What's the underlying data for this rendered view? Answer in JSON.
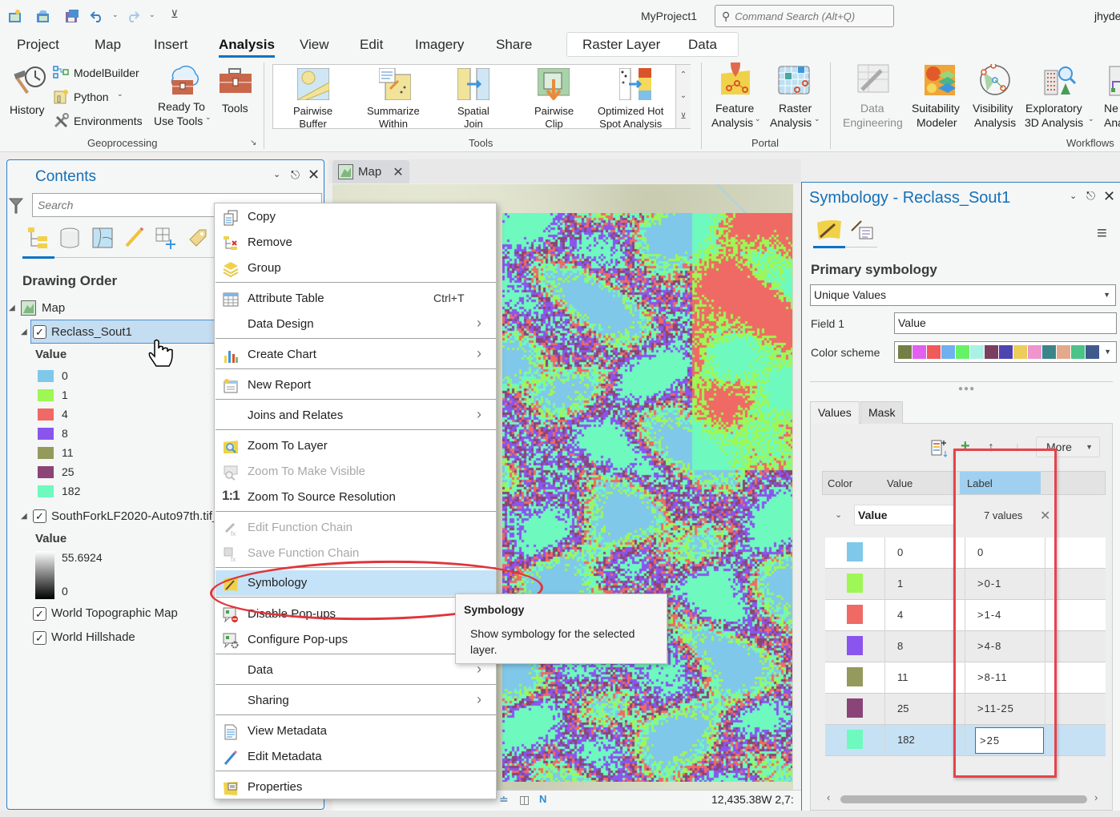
{
  "app": {
    "project_name": "MyProject1",
    "command_search_placeholder": "Command Search (Alt+Q)",
    "user": "jhyde"
  },
  "quick_access": {
    "icons": [
      "new-project-icon",
      "open-project-icon",
      "save-project-icon",
      "undo-icon",
      "redo-icon",
      "customize-toolbar-icon"
    ]
  },
  "ribbon_tabs": [
    {
      "label": "Project",
      "active": false
    },
    {
      "label": "Map",
      "active": false
    },
    {
      "label": "Insert",
      "active": false
    },
    {
      "label": "Analysis",
      "active": true
    },
    {
      "label": "View",
      "active": false
    },
    {
      "label": "Edit",
      "active": false
    },
    {
      "label": "Imagery",
      "active": false
    },
    {
      "label": "Share",
      "active": false
    }
  ],
  "contextual_tabs": [
    {
      "label": "Raster Layer"
    },
    {
      "label": "Data"
    }
  ],
  "ribbon": {
    "geoprocessing": {
      "group_label": "Geoprocessing",
      "history": "History",
      "modelbuilder": "ModelBuilder",
      "python": "Python",
      "environments": "Environments",
      "ready_to_use_1": "Ready To",
      "ready_to_use_2": "Use Tools",
      "tools": "Tools"
    },
    "tools": {
      "group_label": "Tools",
      "items": [
        {
          "line1": "Pairwise",
          "line2": "Buffer"
        },
        {
          "line1": "Summarize",
          "line2": "Within"
        },
        {
          "line1": "Spatial",
          "line2": "Join"
        },
        {
          "line1": "Pairwise",
          "line2": "Clip"
        },
        {
          "line1": "Optimized Hot",
          "line2": "Spot Analysis"
        }
      ]
    },
    "portal": {
      "group_label": "Portal",
      "feature_1": "Feature",
      "feature_2": "Analysis",
      "raster_1": "Raster",
      "raster_2": "Analysis"
    },
    "workflows": {
      "group_label": "Workflows",
      "data_eng_1": "Data",
      "data_eng_2": "Engineering",
      "suit_1": "Suitability",
      "suit_2": "Modeler",
      "vis_1": "Visibility",
      "vis_2": "Analysis",
      "expl_1": "Exploratory",
      "expl_2": "3D Analysis",
      "net_1": "Ne",
      "net_2": "Ana"
    }
  },
  "contents": {
    "title": "Contents",
    "search_placeholder": "Search",
    "drawing_order": "Drawing Order",
    "map_label": "Map",
    "layers": [
      {
        "name": "Reclass_Sout1",
        "checked": true,
        "selected": true,
        "legend_header": "Value",
        "legend": [
          {
            "value": "0",
            "color": "#7fc8ea"
          },
          {
            "value": "1",
            "color": "#9ef754"
          },
          {
            "value": "4",
            "color": "#ef6a64"
          },
          {
            "value": "8",
            "color": "#8a55ee"
          },
          {
            "value": "11",
            "color": "#949a5c"
          },
          {
            "value": "25",
            "color": "#8a4477"
          },
          {
            "value": "182",
            "color": "#6ef9bf"
          }
        ]
      },
      {
        "name": "SouthForkLF2020-Auto97th.tif_",
        "checked": true,
        "legend_header": "Value",
        "ramp_max": "55.6924",
        "ramp_min": "0"
      },
      {
        "name": "World Topographic Map",
        "checked": true
      },
      {
        "name": "World Hillshade",
        "checked": true
      }
    ]
  },
  "map_view": {
    "tab_label": "Map",
    "coordinates": "12,435.38W 2,7:"
  },
  "context_menu": {
    "items": [
      {
        "label": "Copy",
        "icon": "copy-icon"
      },
      {
        "label": "Remove",
        "icon": "remove-layer-icon"
      },
      {
        "label": "Group",
        "icon": "group-layers-icon"
      },
      {
        "label": "Attribute Table",
        "icon": "attribute-table-icon",
        "shortcut": "Ctrl+T"
      },
      {
        "label": "Data Design",
        "submenu": true
      },
      {
        "label": "Create Chart",
        "icon": "chart-icon",
        "submenu": true
      },
      {
        "label": "New Report",
        "icon": "report-icon"
      },
      {
        "label": "Joins and Relates",
        "submenu": true
      },
      {
        "label": "Zoom To Layer",
        "icon": "zoom-layer-icon"
      },
      {
        "label": "Zoom To Make Visible",
        "icon": "zoom-visible-icon",
        "disabled": true
      },
      {
        "label": "Zoom To Source Resolution",
        "icon": "one-to-one-icon"
      },
      {
        "label": "Edit Function Chain",
        "icon": "function-chain-icon",
        "disabled": true
      },
      {
        "label": "Save Function Chain",
        "icon": "save-function-chain-icon",
        "disabled": true
      },
      {
        "label": "Symbology",
        "icon": "symbology-icon",
        "highlighted": true
      },
      {
        "label": "Disable Pop-ups",
        "icon": "disable-popups-icon"
      },
      {
        "label": "Configure Pop-ups",
        "icon": "configure-popups-icon"
      },
      {
        "label": "Data",
        "submenu": true
      },
      {
        "label": "Sharing",
        "submenu": true
      },
      {
        "label": "View Metadata",
        "icon": "view-metadata-icon"
      },
      {
        "label": "Edit Metadata",
        "icon": "edit-metadata-icon"
      },
      {
        "label": "Properties",
        "icon": "properties-icon"
      }
    ],
    "one_to_one_glyph": "1:1"
  },
  "tooltip": {
    "title": "Symbology",
    "body": "Show symbology for the selected layer."
  },
  "symbology": {
    "title": "Symbology - Reclass_Sout1",
    "primary_label": "Primary symbology",
    "primary_value": "Unique Values",
    "field1_label": "Field 1",
    "field1_value": "Value",
    "color_scheme_label": "Color scheme",
    "color_scheme": [
      "#757f45",
      "#e060f0",
      "#f05a5a",
      "#6fb0ee",
      "#66f266",
      "#aaf2e4",
      "#7a3f60",
      "#4d44b0",
      "#eccd5a",
      "#ee95cd",
      "#3c8488",
      "#e4a98a",
      "#4ac487",
      "#405a90"
    ],
    "tabs": [
      {
        "label": "Values",
        "active": true
      },
      {
        "label": "Mask",
        "active": false
      }
    ],
    "more_label": "More",
    "columns": [
      "Color",
      "Value",
      "Label"
    ],
    "group_field": "Value",
    "value_count": "7 values",
    "rows": [
      {
        "color": "#7fc8ea",
        "value": "0",
        "label": "0"
      },
      {
        "color": "#9ef754",
        "value": "1",
        "label": ">0-1"
      },
      {
        "color": "#ef6a64",
        "value": "4",
        "label": ">1-4"
      },
      {
        "color": "#8a55ee",
        "value": "8",
        "label": ">4-8"
      },
      {
        "color": "#949a5c",
        "value": "11",
        "label": ">8-11"
      },
      {
        "color": "#8a4477",
        "value": "25",
        "label": ">11-25"
      },
      {
        "color": "#6ef9bf",
        "value": "182",
        "label": ">25",
        "editing": true
      }
    ]
  }
}
